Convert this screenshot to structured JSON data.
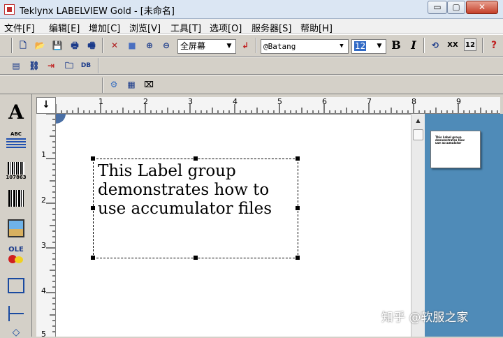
{
  "window": {
    "title": "Teklynx LABELVIEW Gold - [未命名]",
    "min_glyph": "▭",
    "max_glyph": "▢",
    "close_glyph": "✕"
  },
  "menu": [
    "文件[F]",
    "编辑[E]",
    "增加[C]",
    "浏览[V]",
    "工具[T]",
    "选项[O]",
    "服务器[S]",
    "帮助[H]"
  ],
  "toolbar": {
    "zoom_value": "全屏幕",
    "font_value": "@Batang",
    "size_value": "12",
    "bold_label": "B",
    "italic_label": "I",
    "xx_label": "XX",
    "twelve_label": "12",
    "help_label": "?"
  },
  "palette": {
    "text_tool": "A",
    "para_tool": "ABC",
    "barcode_num": "107863",
    "ole_label": "OLE"
  },
  "ruler": {
    "h_numbers": [
      "1",
      "2",
      "3",
      "4",
      "5",
      "6",
      "7",
      "8",
      "9"
    ],
    "v_numbers": [
      "1",
      "2",
      "3",
      "4",
      "5"
    ],
    "corner_glyph": "↓"
  },
  "label": {
    "lines": [
      "This Label group",
      "demonstrates how to",
      "use accumulator files"
    ]
  },
  "preview": {
    "thumb_lines": [
      "This Label group",
      "demonstrates how",
      "use accumulator"
    ]
  },
  "watermark": "知乎 @软服之家",
  "colors": {
    "preview_bg": "#4f8bb8",
    "title_bg": "#dbe6f3",
    "chrome": "#d4d0c8"
  }
}
